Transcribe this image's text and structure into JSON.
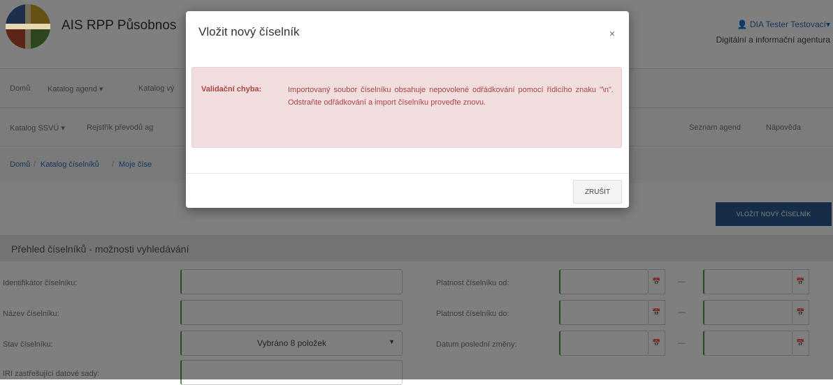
{
  "header": {
    "app_title": "AIS RPP Působnos",
    "user": "DIA Tester Testovací",
    "agency": "Digitální a informační agentura"
  },
  "nav1": [
    "Domů",
    "Katalog agend",
    "Katalog vý"
  ],
  "nav2": {
    "left": [
      "Katalog SSVÚ",
      "Rejstřík převodů ag"
    ],
    "right": [
      "Seznam agend",
      "Nápověda"
    ]
  },
  "breadcrumb": [
    "Domů",
    "Katalog číselníků",
    "Moje číse"
  ],
  "add_button": "VLOŽIT NOVÝ ČÍSELNÍK",
  "search": {
    "title": "Přehled číselníků - možnosti vyhledávání",
    "labels_left": [
      "Identifikátor číselníku:",
      "Název číselníku:",
      "Stav číselníku:",
      "IRI zastřešující datové sady:"
    ],
    "status_select": "Vybráno 8 položek",
    "labels_right": [
      "Platnost číselníku od:",
      "Platnost číselníku do:",
      "Datum poslední změny:"
    ]
  },
  "modal": {
    "title": "Vložit nový číselník",
    "close_symbol": "×",
    "error_label": "Validační chyba:",
    "error_message": "Importovaný soubor číselníku obsahuje nepovolené odřádkování pomocí řídicího znaku \"\\n\". Odstraňte odřádkování a import číselníku proveďte znovu.",
    "cancel_label": "ZRUŠIT"
  }
}
